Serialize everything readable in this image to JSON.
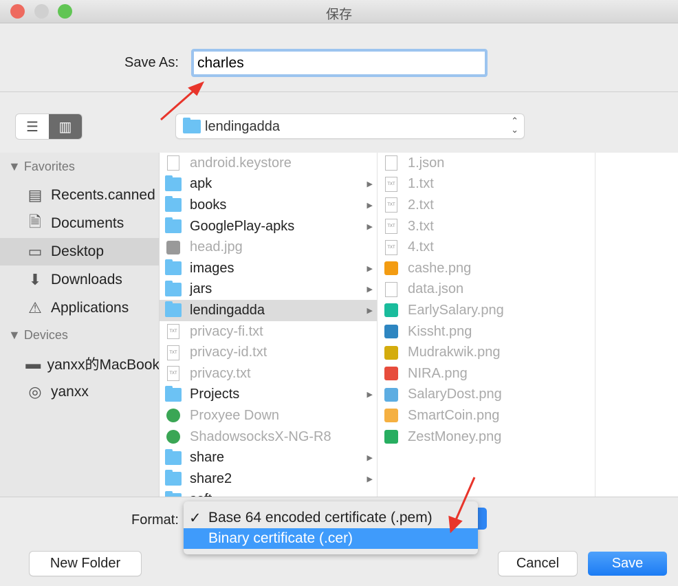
{
  "window": {
    "title": "保存"
  },
  "save_as": {
    "label": "Save As:",
    "value": "charles"
  },
  "toolbar": {
    "view_list_icon": "list-icon",
    "view_column_icon": "columns-icon",
    "location": "lendingadda"
  },
  "sidebar": {
    "favorites_header": "Favorites",
    "favorites": [
      {
        "label": "Recents.canned",
        "icon": "recents-icon"
      },
      {
        "label": "Documents",
        "icon": "documents-icon"
      },
      {
        "label": "Desktop",
        "icon": "desktop-icon",
        "selected": true
      },
      {
        "label": "Downloads",
        "icon": "downloads-icon"
      },
      {
        "label": "Applications",
        "icon": "applications-icon"
      }
    ],
    "devices_header": "Devices",
    "devices": [
      {
        "label": "yanxx的MacBook",
        "icon": "laptop-icon"
      },
      {
        "label": "yanxx",
        "icon": "disk-icon"
      }
    ]
  },
  "column1": [
    {
      "name": "android.keystore",
      "type": "file"
    },
    {
      "name": "apk",
      "type": "folder"
    },
    {
      "name": "books",
      "type": "folder"
    },
    {
      "name": "GooglePlay-apks",
      "type": "folder"
    },
    {
      "name": "head.jpg",
      "type": "image"
    },
    {
      "name": "images",
      "type": "folder"
    },
    {
      "name": "jars",
      "type": "folder"
    },
    {
      "name": "lendingadda",
      "type": "folder",
      "selected": true
    },
    {
      "name": "privacy-fi.txt",
      "type": "txt"
    },
    {
      "name": "privacy-id.txt",
      "type": "txt"
    },
    {
      "name": "privacy.txt",
      "type": "txt"
    },
    {
      "name": "Projects",
      "type": "folder"
    },
    {
      "name": "Proxyee Down",
      "type": "app"
    },
    {
      "name": "ShadowsocksX-NG-R8",
      "type": "app"
    },
    {
      "name": "share",
      "type": "folder"
    },
    {
      "name": "share2",
      "type": "folder"
    },
    {
      "name": "soft",
      "type": "folder"
    }
  ],
  "column2": [
    {
      "name": "1.json",
      "type": "file"
    },
    {
      "name": "1.txt",
      "type": "txt"
    },
    {
      "name": "2.txt",
      "type": "txt"
    },
    {
      "name": "3.txt",
      "type": "txt"
    },
    {
      "name": "4.txt",
      "type": "txt"
    },
    {
      "name": "cashe.png",
      "type": "image",
      "color": "#f39c12"
    },
    {
      "name": "data.json",
      "type": "file"
    },
    {
      "name": "EarlySalary.png",
      "type": "image",
      "color": "#1abc9c"
    },
    {
      "name": "Kissht.png",
      "type": "image",
      "color": "#2e86c1"
    },
    {
      "name": "Mudrakwik.png",
      "type": "image",
      "color": "#d4ac0d"
    },
    {
      "name": "NIRA.png",
      "type": "image",
      "color": "#e74c3c"
    },
    {
      "name": "SalaryDost.png",
      "type": "image",
      "color": "#5dade2"
    },
    {
      "name": "SmartCoin.png",
      "type": "image",
      "color": "#f5b041"
    },
    {
      "name": "ZestMoney.png",
      "type": "image",
      "color": "#27ae60"
    }
  ],
  "format": {
    "label": "Format:",
    "options": [
      {
        "label": "Base 64 encoded certificate (.pem)",
        "checked": true
      },
      {
        "label": "Binary certificate (.cer)",
        "highlighted": true
      }
    ]
  },
  "buttons": {
    "new_folder": "New Folder",
    "cancel": "Cancel",
    "save": "Save"
  },
  "colors": {
    "accent": "#1c7cf4",
    "highlight": "#3f9bfb",
    "annotation": "#e8352b"
  }
}
